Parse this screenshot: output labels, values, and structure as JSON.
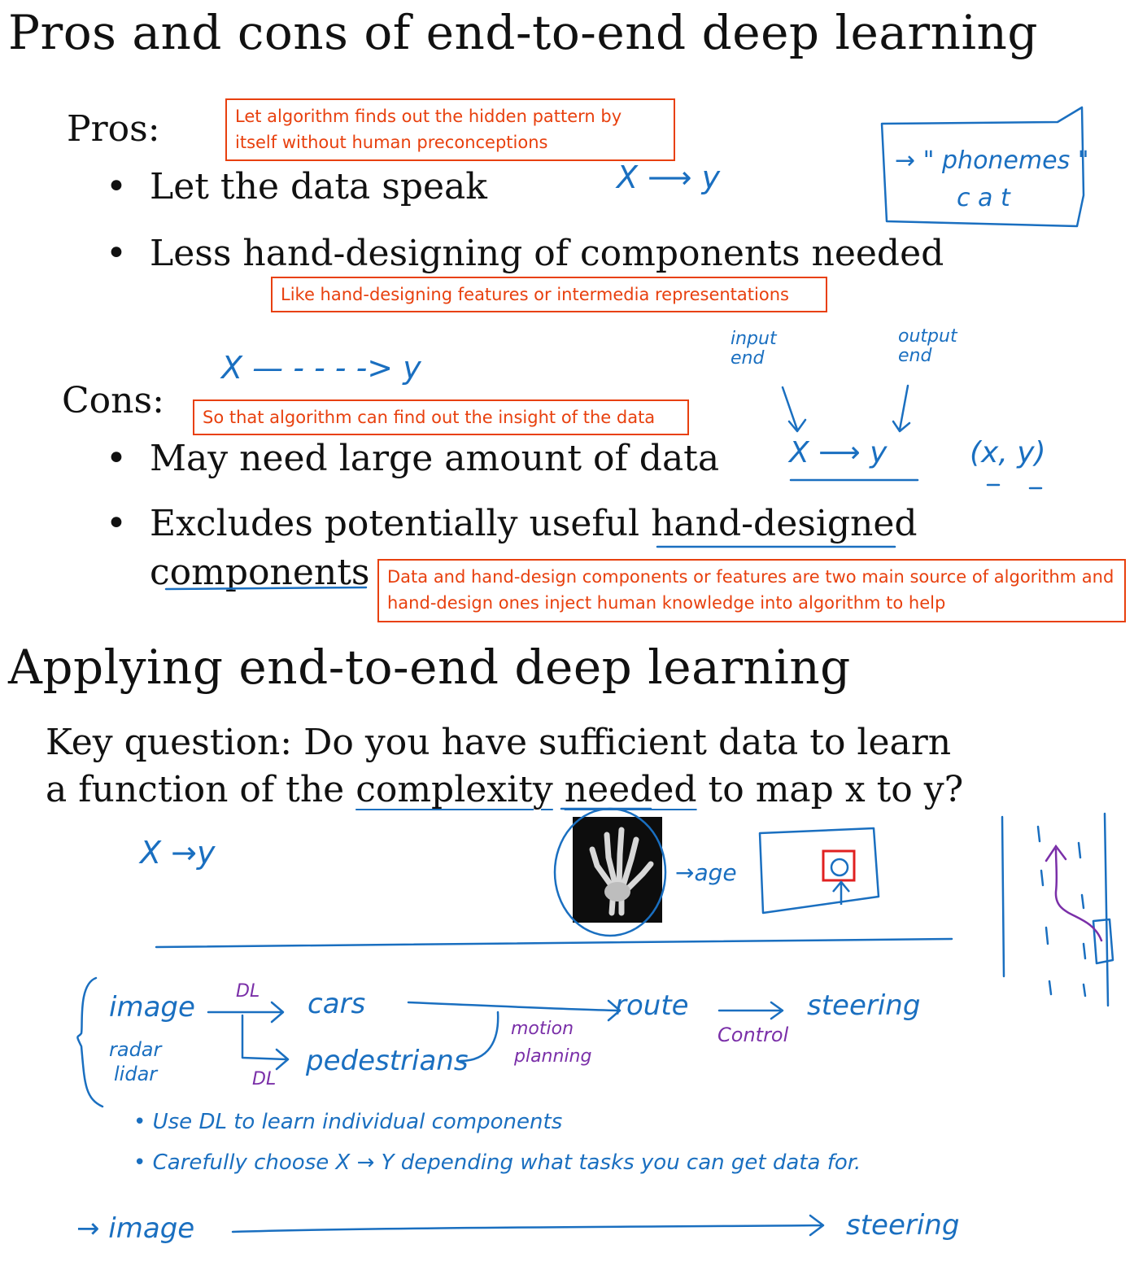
{
  "slide1": {
    "title": "Pros and cons of end-to-end deep learning",
    "pros_label": "Pros:",
    "pros": [
      "Let the data speak",
      "Less hand-designing of components needed"
    ],
    "cons_label": "Cons:",
    "cons": [
      "May need large amount of data",
      "Excludes potentially useful ",
      "hand-designed",
      "components"
    ],
    "notes": {
      "note1": "Let algorithm finds out the hidden pattern by itself without human preconceptions",
      "note2": "Like hand-designing features or intermedia representations",
      "note3": "So that algorithm can find out the insight of the data",
      "note4": "Data and hand-design components or features are two main source of algorithm and  hand-design ones inject human knowledge into algorithm to help"
    },
    "handwriting": {
      "x_to_y": "X ⟶ y",
      "phonemes": "→ \" phonemes \"",
      "cat": "c a t",
      "x_dashed_y": "X — -      -   - -> y",
      "input_end": "input end",
      "output_end": "output end",
      "x_y_arrow": "X ⟶ y",
      "xy_pair": "(x, y)"
    }
  },
  "slide2": {
    "title": "Applying end-to-end deep learning",
    "key_question_line1": "Key question: Do you have sufficient data to learn",
    "key_question_line2_a": "a function of the ",
    "key_question_line2_u1": "complexity",
    "key_question_line2_b": " ",
    "key_question_line2_u2": "needed",
    "key_question_line2_c": " to map x to y?",
    "handwriting": {
      "x_to_y": "X →y",
      "age": "→age",
      "image": "image",
      "radar": "radar",
      "lidar": "lidar",
      "dl1": "DL",
      "dl2": "DL",
      "cars": "cars",
      "pedestrians": "pedestrians",
      "motion": "motion",
      "planning": "planning",
      "route": "route",
      "control": "Control",
      "steering": "steering",
      "bullet1": "• Use   DL   to   learn   individual   components",
      "bullet2": "• Carefully   choose   X → Y   depending   what   tasks   you   can   get   data   for.",
      "image2": "→ image",
      "steering2": "steering"
    }
  },
  "colors": {
    "ink_blue": "#1a6fc0",
    "ink_purple": "#7a2fa8",
    "note_red": "#e8400e"
  }
}
